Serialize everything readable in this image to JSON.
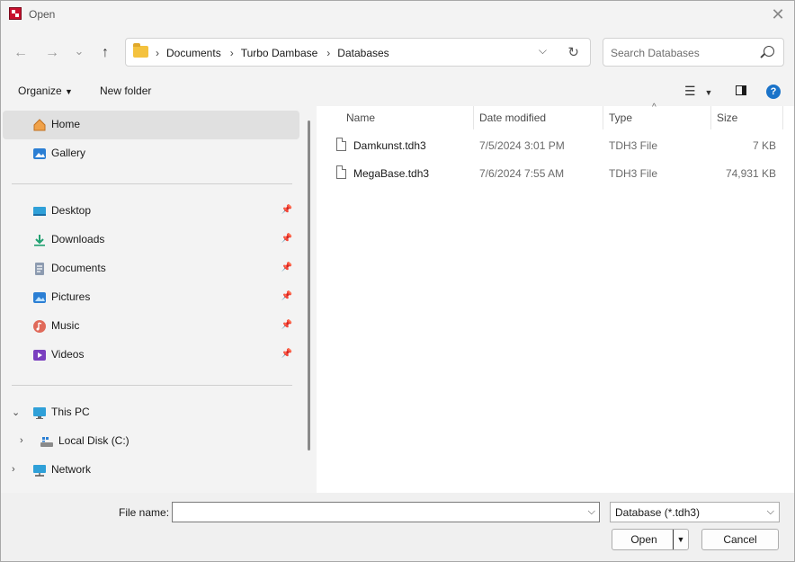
{
  "window": {
    "title": "Open"
  },
  "nav": {
    "back": "←",
    "forward": "→",
    "recent": "⌄",
    "up": "↑",
    "breadcrumbs": [
      "Documents",
      "Turbo Dambase",
      "Databases"
    ],
    "search_placeholder": "Search Databases"
  },
  "commandbar": {
    "organize": "Organize",
    "new_folder": "New folder",
    "help": "?"
  },
  "sidebar": {
    "quick": [
      {
        "label": "Home",
        "icon": "home-icon",
        "selected": true
      },
      {
        "label": "Gallery",
        "icon": "gallery-icon"
      }
    ],
    "pinned": [
      {
        "label": "Desktop",
        "icon": "desktop-icon"
      },
      {
        "label": "Downloads",
        "icon": "download-icon"
      },
      {
        "label": "Documents",
        "icon": "documents-icon"
      },
      {
        "label": "Pictures",
        "icon": "pictures-icon"
      },
      {
        "label": "Music",
        "icon": "music-icon"
      },
      {
        "label": "Videos",
        "icon": "videos-icon"
      }
    ],
    "tree": [
      {
        "label": "This PC",
        "icon": "computer-icon",
        "expanded": true
      },
      {
        "label": "Local Disk (C:)",
        "icon": "disk-icon"
      },
      {
        "label": "Network",
        "icon": "network-icon"
      }
    ]
  },
  "filelist": {
    "columns": [
      "Name",
      "Date modified",
      "Type",
      "Size"
    ],
    "files": [
      {
        "name": "Damkunst.tdh3",
        "date": "7/5/2024 3:01 PM",
        "type": "TDH3 File",
        "size": "7 KB"
      },
      {
        "name": "MegaBase.tdh3",
        "date": "7/6/2024 7:55 AM",
        "type": "TDH3 File",
        "size": "74,931 KB"
      }
    ]
  },
  "footer": {
    "file_name_label": "File name:",
    "file_name_value": "",
    "file_type": "Database (*.tdh3)",
    "open": "Open",
    "cancel": "Cancel"
  },
  "colors": {
    "accent": "#1a73c9",
    "selection": "#e0e0e0",
    "folder": "#f4c23e"
  }
}
